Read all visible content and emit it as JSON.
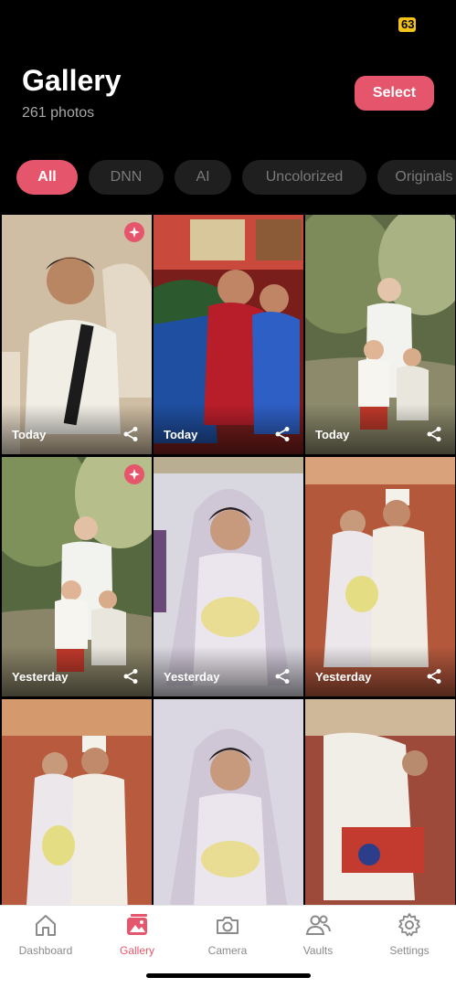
{
  "status": {
    "badge": "63"
  },
  "header": {
    "title": "Gallery",
    "count": "261 photos",
    "select_label": "Select"
  },
  "filters": [
    {
      "label": "All",
      "active": true
    },
    {
      "label": "DNN",
      "active": false
    },
    {
      "label": "AI",
      "active": false
    },
    {
      "label": "Uncolorized",
      "active": false
    },
    {
      "label": "Originals",
      "active": false
    }
  ],
  "photos": [
    {
      "date": "Today",
      "ai": true
    },
    {
      "date": "Today",
      "ai": false
    },
    {
      "date": "Today",
      "ai": false
    },
    {
      "date": "Yesterday",
      "ai": true
    },
    {
      "date": "Yesterday",
      "ai": false
    },
    {
      "date": "Yesterday",
      "ai": false
    },
    {
      "date": "",
      "ai": false
    },
    {
      "date": "",
      "ai": false
    },
    {
      "date": "",
      "ai": false
    }
  ],
  "tabs": [
    {
      "label": "Dashboard",
      "icon": "home-icon",
      "active": false
    },
    {
      "label": "Gallery",
      "icon": "gallery-icon",
      "active": true
    },
    {
      "label": "Camera",
      "icon": "camera-icon",
      "active": false
    },
    {
      "label": "Vaults",
      "icon": "people-icon",
      "active": false
    },
    {
      "label": "Settings",
      "icon": "gear-icon",
      "active": false
    }
  ],
  "colors": {
    "accent": "#e5566c",
    "background": "#000000",
    "tabbar": "#ffffff"
  }
}
